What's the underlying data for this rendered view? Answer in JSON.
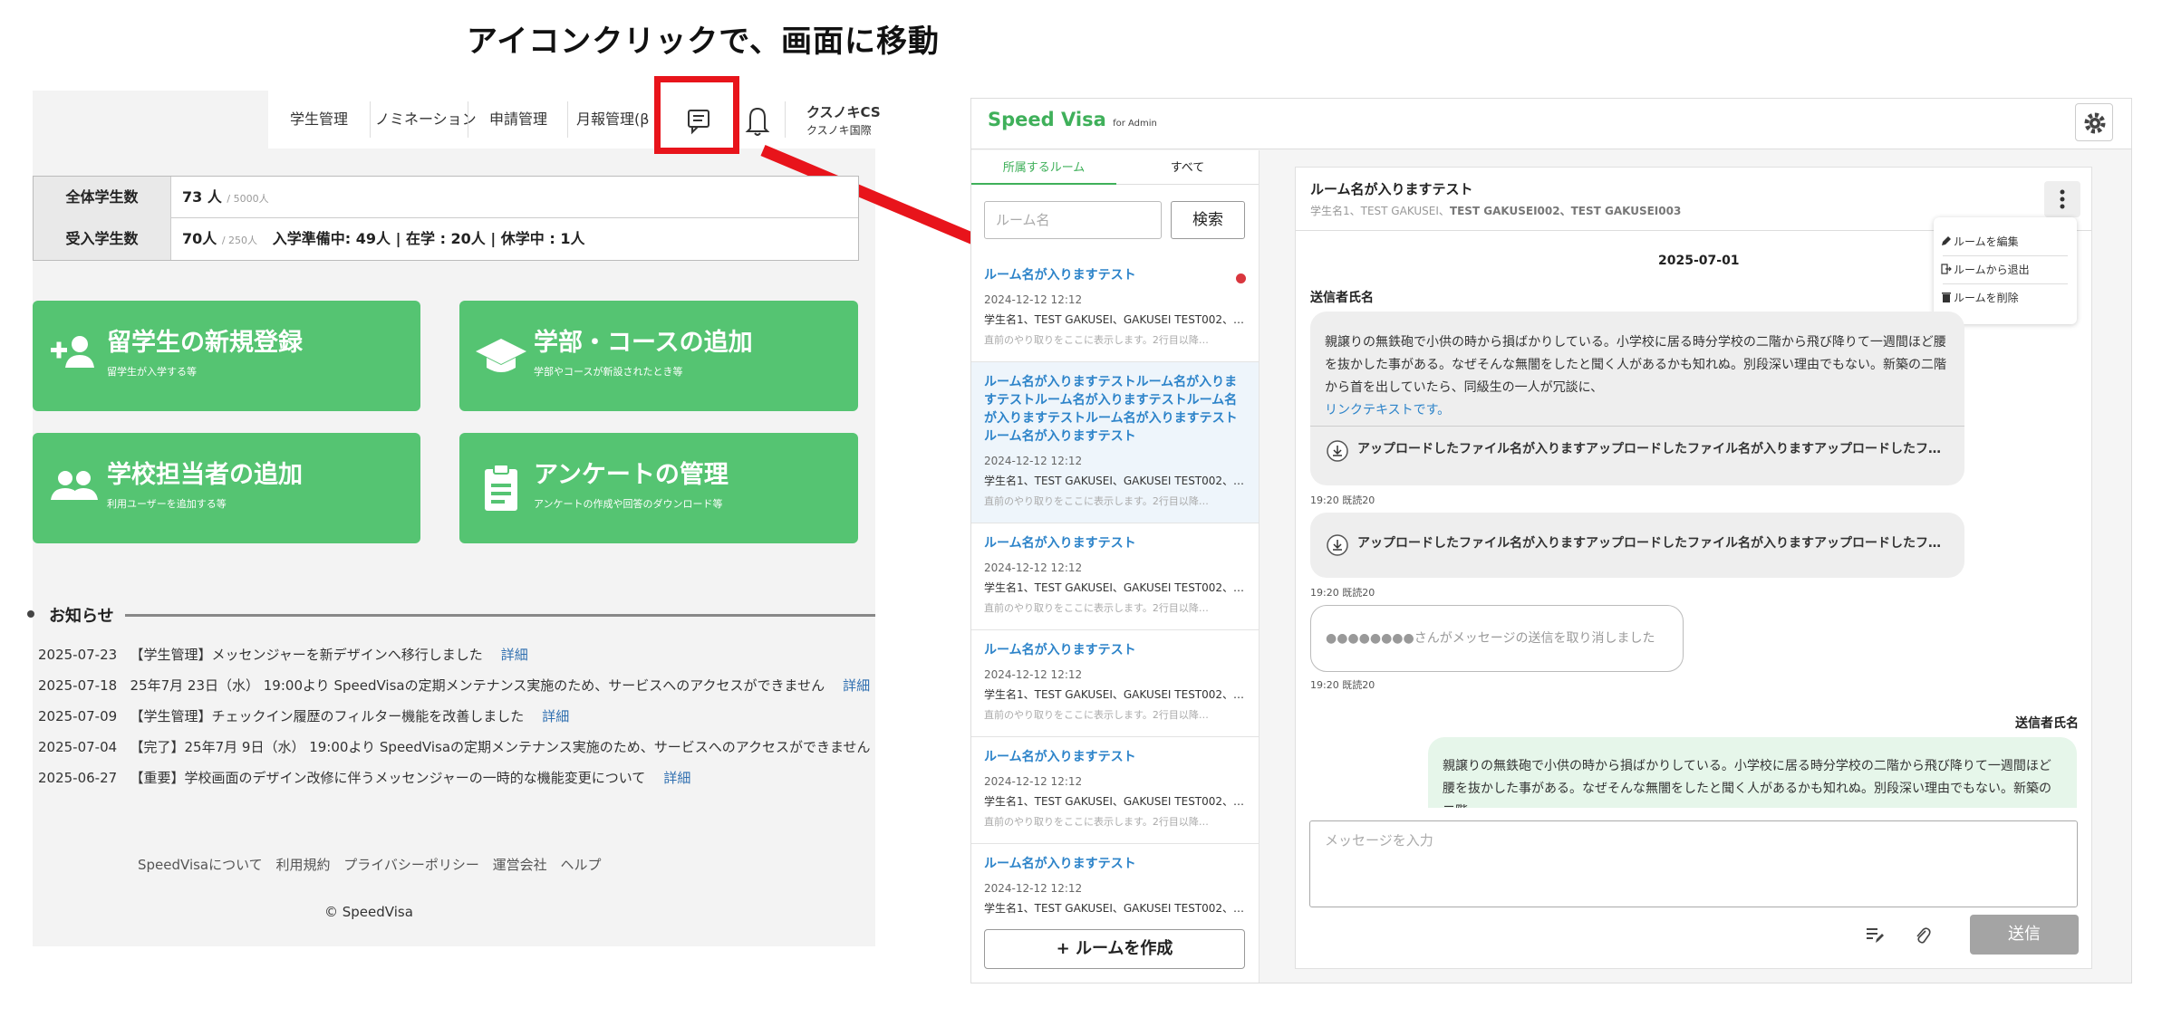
{
  "caption": "アイコンクリックで、画面に移動",
  "left_nav": {
    "items": [
      "学生管理",
      "ノミネーション",
      "申請管理",
      "月報管理(β"
    ],
    "user_name": "クスノキCS",
    "user_org": "クスノキ国際"
  },
  "stats": {
    "rows": [
      {
        "label": "全体学生数",
        "value": "73 人",
        "sub": "/ 5000人",
        "extra": ""
      },
      {
        "label": "受入学生数",
        "value": "70人",
        "sub": "/ 250人",
        "extra": "入学準備中: 49人 | 在学 : 20人 | 休学中 : 1人"
      }
    ]
  },
  "cards": [
    {
      "title": "留学生の新規登録",
      "sub": "留学生が入学する等",
      "icon": "add-person-icon"
    },
    {
      "title": "学部・コースの追加",
      "sub": "学部やコースが新設されたとき等",
      "icon": "graduation-cap-icon"
    },
    {
      "title": "学校担当者の追加",
      "sub": "利用ユーザーを追加する等",
      "icon": "group-icon"
    },
    {
      "title": "アンケートの管理",
      "sub": "アンケートの作成や回答のダウンロード等",
      "icon": "clipboard-icon"
    }
  ],
  "news": {
    "title": "お知らせ",
    "link_label": "詳細",
    "items": [
      {
        "date": "2025-07-23",
        "text": "【学生管理】メッセンジャーを新デザインへ移行しました"
      },
      {
        "date": "2025-07-18",
        "text": "25年7月 23日（水） 19:00より SpeedVisaの定期メンテナンス実施のため、サービスへのアクセスができません"
      },
      {
        "date": "2025-07-09",
        "text": "【学生管理】チェックイン履歴のフィルター機能を改善しました"
      },
      {
        "date": "2025-07-04",
        "text": "【完了】25年7月 9日（水） 19:00より SpeedVisaの定期メンテナンス実施のため、サービスへのアクセスができません"
      },
      {
        "date": "2025-06-27",
        "text": "【重要】学校画面のデザイン改修に伴うメッセンジャーの一時的な機能変更について"
      }
    ]
  },
  "footer": {
    "links": "SpeedVisaについて 利用規約 プライバシーポリシー 運営会社 ヘルプ",
    "copyright": "© SpeedVisa"
  },
  "app": {
    "brand": "Speed Visa",
    "brand_sub": "for Admin",
    "tabs": [
      "所属するルーム",
      "すべて"
    ],
    "search_placeholder": "ルーム名",
    "search_button": "検索",
    "rooms": [
      {
        "name": "ルーム名が入りますテスト",
        "date": "2024-12-12 12:12",
        "members": "学生名1、TEST GAKUSEI、GAKUSEI TEST002、…",
        "preview": "直前のやり取りをここに表示します。2行目以降…",
        "unread": true
      },
      {
        "name": "ルーム名が入りますテストルーム名が入りますテストルーム名が入りますテストルーム名が入りますテストルーム名が入りますテストルーム名が入りますテスト",
        "date": "2024-12-12 12:12",
        "members": "学生名1、TEST GAKUSEI、GAKUSEI TEST002、…",
        "preview": "直前のやり取りをここに表示します。2行目以降…",
        "unread": false
      },
      {
        "name": "ルーム名が入りますテスト",
        "date": "2024-12-12 12:12",
        "members": "学生名1、TEST GAKUSEI、GAKUSEI TEST002、…",
        "preview": "直前のやり取りをここに表示します。2行目以降…",
        "unread": false
      },
      {
        "name": "ルーム名が入りますテスト",
        "date": "2024-12-12 12:12",
        "members": "学生名1、TEST GAKUSEI、GAKUSEI TEST002、…",
        "preview": "直前のやり取りをここに表示します。2行目以降…",
        "unread": false
      },
      {
        "name": "ルーム名が入りますテスト",
        "date": "2024-12-12 12:12",
        "members": "学生名1、TEST GAKUSEI、GAKUSEI TEST002、…",
        "preview": "直前のやり取りをここに表示します。2行目以降…",
        "unread": false
      },
      {
        "name": "ルーム名が入りますテスト",
        "date": "2024-12-12 12:12",
        "members": "学生名1、TEST GAKUSEI、GAKUSEI TEST002、…",
        "preview": "",
        "unread": false
      }
    ],
    "create_room": "+ ルームを作成",
    "chat": {
      "room_name": "ルーム名が入りますテスト",
      "members_plain": "学生名1、TEST GAKUSEI、",
      "members_bold": "TEST GAKUSEI002、TEST GAKUSEI003",
      "menu": [
        "ルームを編集",
        "ルームから退出",
        "ルームを削除"
      ],
      "date": "2025-07-01",
      "sender": "送信者氏名",
      "message": "親譲りの無鉄砲で小供の時から損ばかりしている。小学校に居る時分学校の二階から飛び降りて一週間ほど腰を抜かした事がある。なぜそんな無闇をしたと聞く人があるかも知れぬ。別段深い理由でもない。新築の二階から首を出していたら、同級生の一人が冗談に、",
      "link_text": "リンクテキストです。",
      "file_name": "アップロードしたファイル名が入りますアップロードしたファイル名が入りますアップロードしたフ…",
      "meta": "19:20  既読20",
      "retracted": "●●●●●●●●さんがメッセージの送信を取り消しました",
      "own_message": "親譲りの無鉄砲で小供の時から損ばかりしている。小学校に居る時分学校の二階から飛び降りて一週間ほど腰を抜かした事がある。なぜそんな無闇をしたと聞く人があるかも知れぬ。別段深い理由でもない。新築の二階",
      "composer_placeholder": "メッセージを入力",
      "send": "送信"
    }
  },
  "colors": {
    "accent_green": "#55c472",
    "brand_green": "#3fb05a",
    "highlight_red": "#e8141b",
    "link_blue": "#2c83c9"
  }
}
